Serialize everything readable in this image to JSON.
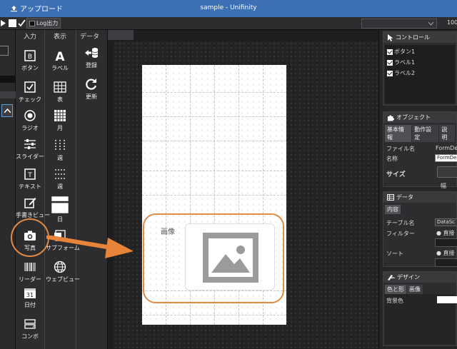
{
  "titlebar": {
    "upload_label": "アップロード",
    "title": "sample - Unifinity"
  },
  "toolbar": {
    "log_label": "Log出力",
    "zoom": "100"
  },
  "palette": {
    "input_header": "入力",
    "display_header": "表示",
    "data_header": "データ",
    "input_items": [
      "ボタン",
      "チェック",
      "ラジオ",
      "スライダー",
      "テキスト",
      "手書きビュー",
      "写真",
      "リーダー",
      "日付",
      "コンボ"
    ],
    "display_items": [
      "ラベル",
      "表",
      "月",
      "週",
      "週",
      "日",
      "サブフォーム",
      "ウェブビュー"
    ],
    "data_items": [
      "登録",
      "更新"
    ]
  },
  "canvas": {
    "image_label": "画像"
  },
  "panels": {
    "control": {
      "title": "コントロール",
      "items": [
        "ボタン1",
        "ラベル1",
        "ラベル2"
      ]
    },
    "object": {
      "title": "オブジェクト",
      "tabs": [
        "基本情報",
        "動作設定",
        "説明"
      ],
      "file_label": "ファイル名",
      "file_value": "FormDes",
      "name_label": "名称",
      "name_value": "FormDes",
      "size_label": "サイズ",
      "width_label": "幅"
    },
    "data": {
      "title": "データ",
      "tabs": [
        "内容"
      ],
      "table_label": "テーブル名",
      "table_value": "DataSc",
      "filter_label": "フィルター",
      "filter_option": "直接",
      "sort_label": "ソート",
      "sort_option": "直接"
    },
    "design": {
      "title": "デザイン",
      "tabs": [
        "色と形",
        "画像"
      ],
      "bg_label": "背景色"
    }
  },
  "colors": {
    "accent": "#e08a44",
    "titlebar": "#3c6fb4"
  }
}
